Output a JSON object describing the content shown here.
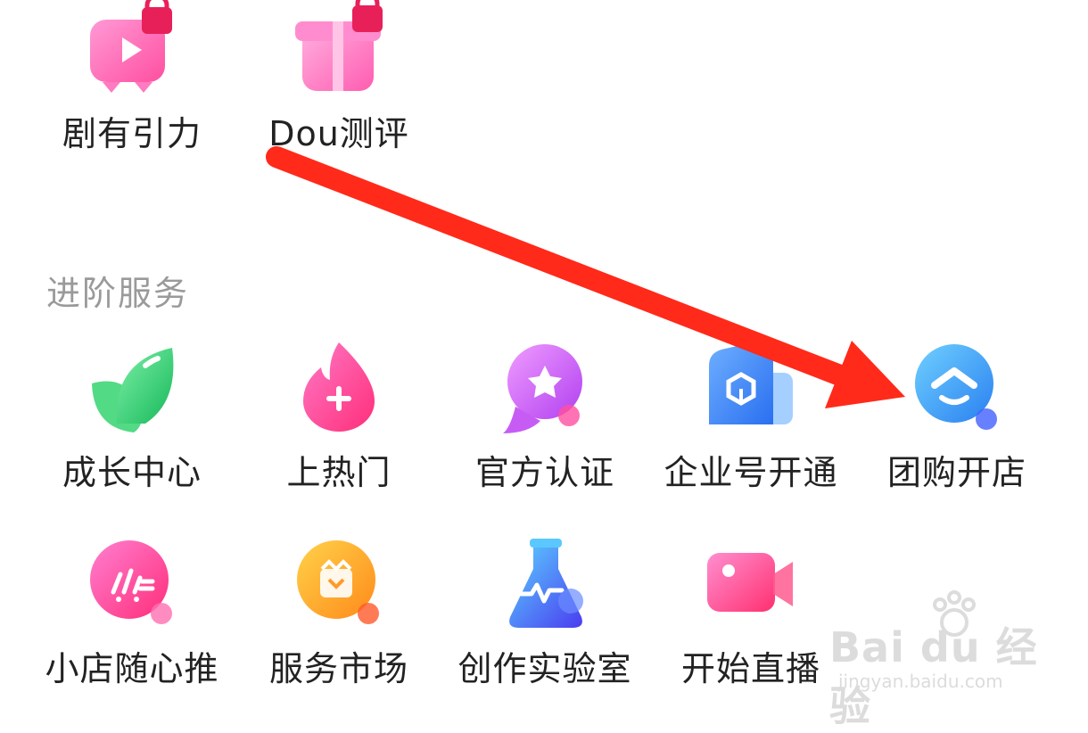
{
  "sections": {
    "top_items": [
      {
        "label": "剧有引力",
        "icon": "tv-play-lock-icon"
      },
      {
        "label": "Dou测评",
        "icon": "gift-box-lock-icon"
      }
    ],
    "advanced": {
      "title": "进阶服务",
      "row1": [
        {
          "label": "成长中心",
          "icon": "leaf-icon"
        },
        {
          "label": "上热门",
          "icon": "flame-plus-icon"
        },
        {
          "label": "官方认证",
          "icon": "star-chat-icon"
        },
        {
          "label": "企业号开通",
          "icon": "building-cube-icon"
        },
        {
          "label": "团购开店",
          "icon": "group-buy-store-icon"
        }
      ],
      "row2": [
        {
          "label": "小店随心推",
          "icon": "shop-boost-icon"
        },
        {
          "label": "服务市场",
          "icon": "service-bag-icon"
        },
        {
          "label": "创作实验室",
          "icon": "lab-flask-icon"
        },
        {
          "label": "开始直播",
          "icon": "video-camera-icon"
        }
      ]
    }
  },
  "annotation": {
    "type": "red-arrow",
    "target": "团购开店",
    "color": "#ff2a1a"
  },
  "watermark": {
    "main": "Bai du 经验",
    "sub": "jingyan.baidu.com"
  }
}
